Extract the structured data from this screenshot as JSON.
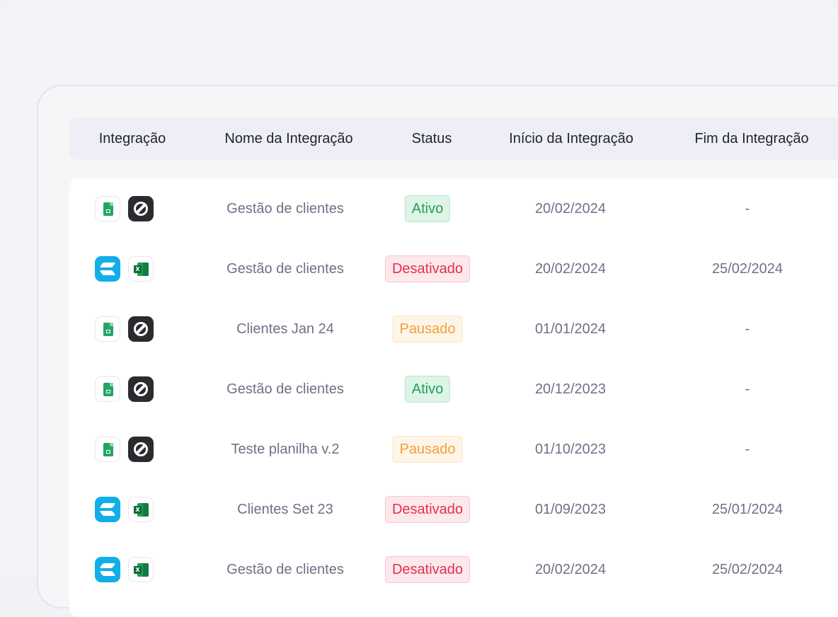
{
  "table": {
    "headers": {
      "integracao": "Integração",
      "nome": "Nome da Integração",
      "status": "Status",
      "inicio": "Início da Integração",
      "fim": "Fim da Integração"
    },
    "rows": [
      {
        "icons": [
          "google-sheets-icon",
          "totvs-icon"
        ],
        "nome": "Gestão de clientes",
        "status": "Ativo",
        "status_type": "ativo",
        "inicio": "20/02/2024",
        "fim": "-"
      },
      {
        "icons": [
          "rd-station-icon",
          "excel-icon"
        ],
        "nome": "Gestão de clientes",
        "status": "Desativado",
        "status_type": "desativado",
        "inicio": "20/02/2024",
        "fim": "25/02/2024"
      },
      {
        "icons": [
          "google-sheets-icon",
          "totvs-icon"
        ],
        "nome": "Clientes Jan 24",
        "status": "Pausado",
        "status_type": "pausado",
        "inicio": "01/01/2024",
        "fim": "-"
      },
      {
        "icons": [
          "google-sheets-icon",
          "totvs-icon"
        ],
        "nome": "Gestão de clientes",
        "status": "Ativo",
        "status_type": "ativo",
        "inicio": "20/12/2023",
        "fim": "-"
      },
      {
        "icons": [
          "google-sheets-icon",
          "totvs-icon"
        ],
        "nome": "Teste planilha v.2",
        "status": "Pausado",
        "status_type": "pausado",
        "inicio": "01/10/2023",
        "fim": "-"
      },
      {
        "icons": [
          "rd-station-icon",
          "excel-icon"
        ],
        "nome": "Clientes Set 23",
        "status": "Desativado",
        "status_type": "desativado",
        "inicio": "01/09/2023",
        "fim": "25/01/2024"
      },
      {
        "icons": [
          "rd-station-icon",
          "excel-icon"
        ],
        "nome": "Gestão de clientes",
        "status": "Desativado",
        "status_type": "desativado",
        "inicio": "20/02/2024",
        "fim": "25/02/2024"
      }
    ]
  },
  "colors": {
    "ativo": "#20a05a",
    "desativado": "#e2304f",
    "pausado": "#f0a13a",
    "header_bg": "#eeeff6",
    "text_muted": "#6e7185"
  }
}
